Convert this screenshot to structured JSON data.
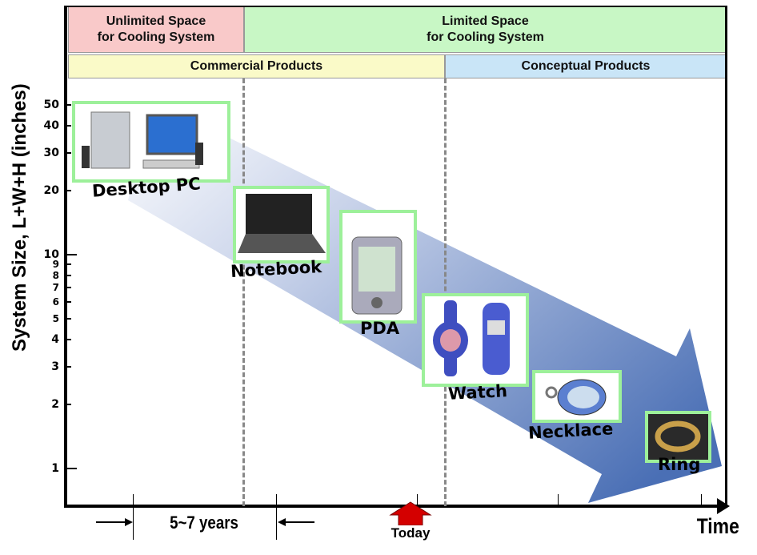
{
  "header": {
    "row1": [
      {
        "label": "Unlimited Space\nfor Cooling System",
        "color": "#f9c9c9"
      },
      {
        "label": "Limited Space\nfor Cooling System",
        "color": "#c8f7c5"
      }
    ],
    "row2": [
      {
        "label": "Commercial Products",
        "color": "#fafac8"
      },
      {
        "label": "Conceptual Products",
        "color": "#c9e5f7"
      }
    ]
  },
  "y_axis": {
    "label": "System Size, L+W+H (inches)",
    "scale": "log",
    "ticks": [
      "50",
      "40",
      "30",
      "20",
      "10",
      "9",
      "8",
      "7",
      "6",
      "5",
      "4",
      "3",
      "2",
      "1"
    ]
  },
  "x_axis": {
    "label": "Time",
    "interval_label": "5~7 years",
    "today_label": "Today",
    "today_color": "#d40000"
  },
  "trend_arrow_color": "#4a6fb5",
  "products": [
    {
      "name": "Desktop PC",
      "size": 30
    },
    {
      "name": "Notebook",
      "size": 12
    },
    {
      "name": "PDA",
      "size": 6
    },
    {
      "name": "Watch",
      "size": 2.5
    },
    {
      "name": "Necklace",
      "size": 1.8
    },
    {
      "name": "Ring",
      "size": 1.3
    }
  ]
}
